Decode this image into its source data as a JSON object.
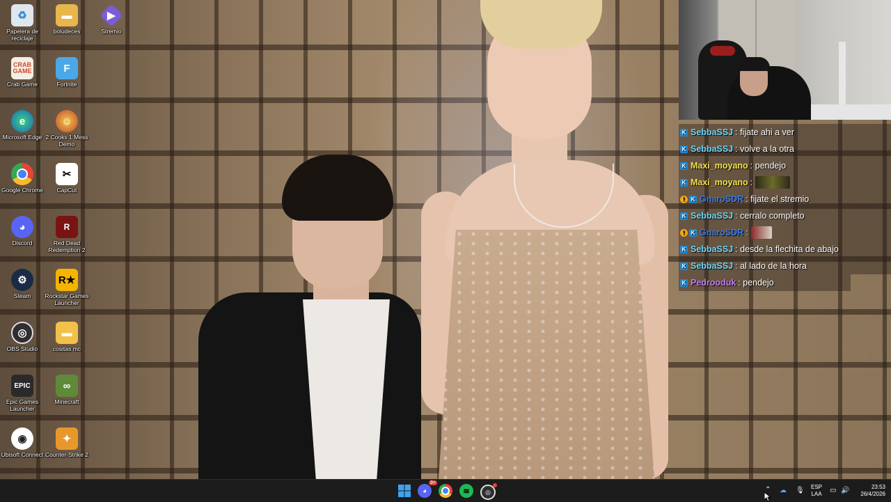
{
  "desktop_icons": [
    {
      "label": "Papelera de reciclaje",
      "icon": "recycle-bin-icon"
    },
    {
      "label": "boludeces",
      "icon": "folder-icon"
    },
    {
      "label": "Stremio",
      "icon": "stremio-icon"
    },
    {
      "label": "Crab Game",
      "icon": "crab-game-icon"
    },
    {
      "label": "Fortnite",
      "icon": "fortnite-icon"
    },
    {
      "label": "Microsoft Edge",
      "icon": "edge-icon"
    },
    {
      "label": "2 Cooks 1 Mess Demo",
      "icon": "game-icon"
    },
    {
      "label": "Google Chrome",
      "icon": "chrome-icon"
    },
    {
      "label": "CapCut",
      "icon": "capcut-icon"
    },
    {
      "label": "Discord",
      "icon": "discord-icon"
    },
    {
      "label": "Red Dead Redemption 2",
      "icon": "rdr2-icon"
    },
    {
      "label": "Steam",
      "icon": "steam-icon"
    },
    {
      "label": "Rockstar Games Launcher",
      "icon": "rockstar-icon"
    },
    {
      "label": "OBS Studio",
      "icon": "obs-icon"
    },
    {
      "label": "cositas mc",
      "icon": "folder-icon"
    },
    {
      "label": "Epic Games Launcher",
      "icon": "epic-games-icon"
    },
    {
      "label": "Minecraft",
      "icon": "minecraft-icon"
    },
    {
      "label": "Ubisoft Connect",
      "icon": "ubisoft-icon"
    },
    {
      "label": "Counter-Strike 2",
      "icon": "cs2-icon"
    }
  ],
  "chat": {
    "messages": [
      {
        "user": "SebbaSSJ",
        "text": ": fijate ahi a ver",
        "color": "#6fd6f5"
      },
      {
        "user": "SebbaSSJ",
        "text": ": volve a la otra",
        "color": "#6fd6f5"
      },
      {
        "user": "Maxi_moyano",
        "text": ": pendejo",
        "color": "#f4e04d"
      },
      {
        "user": "Maxi_moyano",
        "text": ":",
        "color": "#f4e04d"
      },
      {
        "user": "GnaroSDR",
        "text": ": fijate el stremio",
        "color": "#3d7be0"
      },
      {
        "user": "SebbaSSJ",
        "text": ": cerralo completo",
        "color": "#6fd6f5"
      },
      {
        "user": "GnaroSDR",
        "text": ":",
        "color": "#3d7be0"
      },
      {
        "user": "SebbaSSJ",
        "text": ": desde la flechita de abajo",
        "color": "#6fd6f5"
      },
      {
        "user": "SebbaSSJ",
        "text": ": al lado de la hora",
        "color": "#6fd6f5"
      },
      {
        "user": "Pedrooduk",
        "text": ": pendejo",
        "color": "#c27df0"
      }
    ]
  },
  "taskbar": {
    "apps": [
      "windows-start-icon",
      "discord-icon",
      "chrome-icon",
      "spotify-icon",
      "obs-icon"
    ],
    "discord_badge": "9+",
    "lang_top": "ESP",
    "lang_bottom": "LAA",
    "time": "23:53",
    "date": "26/4/2026"
  }
}
